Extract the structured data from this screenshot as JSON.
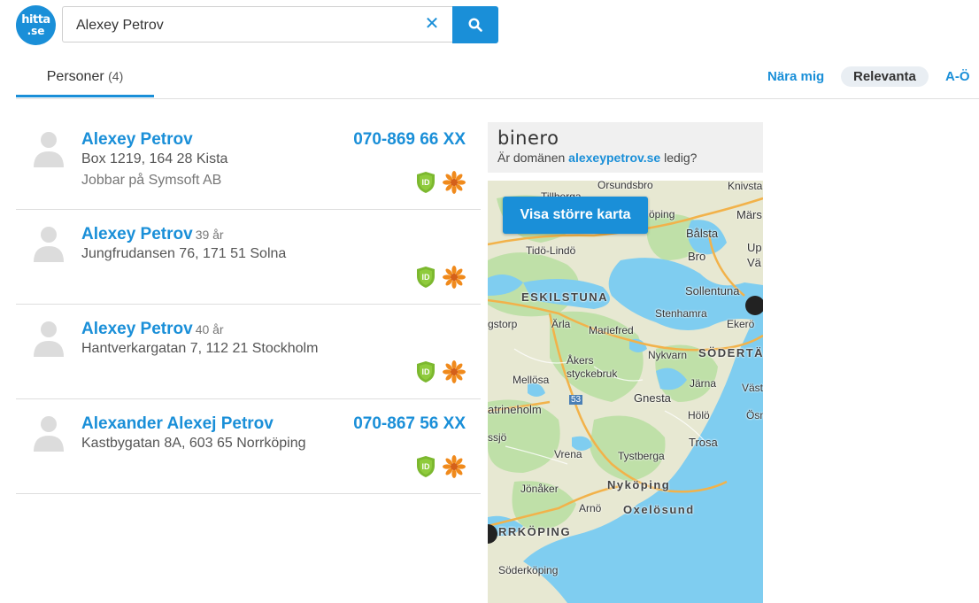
{
  "header": {
    "logo_line1": "hitta",
    "logo_line2": ".se",
    "search_value": "Alexey Petrov"
  },
  "tabs": {
    "persons_label": "Personer",
    "persons_count": "(4)"
  },
  "sort": {
    "near_me": "Nära mig",
    "relevant": "Relevanta",
    "alphabetical": "A-Ö"
  },
  "results": [
    {
      "name": "Alexey Petrov",
      "age": "",
      "address": "Box 1219,  164 28 Kista",
      "work": "Jobbar på Symsoft AB",
      "phone": "070-869 66 XX"
    },
    {
      "name": "Alexey Petrov",
      "age": "39 år",
      "address": "Jungfrudansen 76,  171 51 Solna",
      "work": "",
      "phone": ""
    },
    {
      "name": "Alexey Petrov",
      "age": "40 år",
      "address": "Hantverkargatan 7,  112 21 Stockholm",
      "work": "",
      "phone": ""
    },
    {
      "name": "Alexander Alexej Petrov",
      "age": "",
      "address": "Kastbygatan 8A,  603 65 Norrköping",
      "work": "",
      "phone": "070-867 56 XX"
    }
  ],
  "ad": {
    "logo": "binero",
    "text_before": "Är domänen",
    "domain": "alexeypetrov.se",
    "text_after": "ledig?"
  },
  "map": {
    "button_label": "Visa större karta",
    "road_number": "53",
    "places": {
      "orsundsbro": "Örsundsbro",
      "knivsta": "Knivsta",
      "tillberga": "Tillberga",
      "koping": "öping",
      "marsta": "Märs",
      "balsta": "Bålsta",
      "upplands": "Up",
      "vasby": "Vä",
      "tido": "Tidö-Lindö",
      "bro": "Bro",
      "sollentuna": "Sollentuna",
      "eskilstuna": "ESKILSTUNA",
      "stenhamra": "Stenhamra",
      "ekero": "Ekerö",
      "torshalla": "gstorp",
      "arla": "Ärla",
      "mariefred": "Mariefred",
      "akers": "Åkers",
      "styckebruk": "styckebruk",
      "nykvarn": "Nykvarn",
      "sodertalje": "SÖDERTÄ",
      "mellosa": "Mellösa",
      "jarna": "Järna",
      "vasterhaninge": "Väst",
      "katrineholm": "atrineholm",
      "gnesta": "Gnesta",
      "holo": "Hölö",
      "osmo": "Ösn",
      "flen": "ssjö",
      "trosa": "Trosa",
      "vrena": "Vrena",
      "tystberga": "Tystberga",
      "nykoping": "Nyköping",
      "jonaker": "Jönåker",
      "arno": "Arnö",
      "oxelosund": "Oxelösund",
      "norrkoping": "RRKÖPING",
      "soderkoping": "Söderköping"
    }
  },
  "colors": {
    "accent": "#1a8fd8",
    "id_badge": "#7cb82f",
    "flower": "#f08a1c",
    "water": "#7fcdf0",
    "land": "#e7e8d2",
    "forest": "#bfe0a8"
  }
}
